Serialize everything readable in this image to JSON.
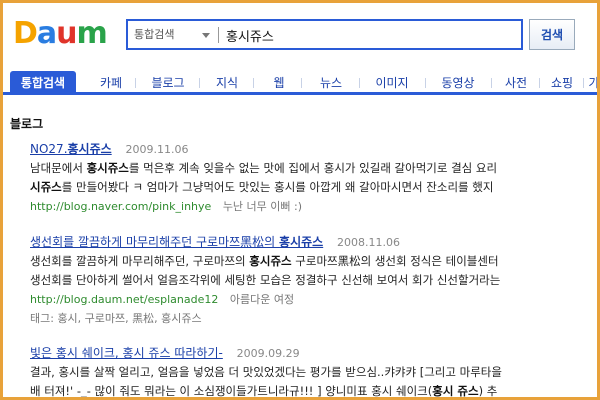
{
  "logo": {
    "letters": [
      "D",
      "a",
      "u",
      "m"
    ],
    "colors": [
      "#f5a300",
      "#2a7de1",
      "#e0342a",
      "#2aa34a"
    ]
  },
  "search": {
    "scope": "통합검색",
    "query": "홍시쥬스",
    "button": "검색"
  },
  "tabs": [
    {
      "label": "통합검색",
      "active": true
    },
    {
      "label": "카페"
    },
    {
      "label": "블로그"
    },
    {
      "label": "지식"
    },
    {
      "label": "웹"
    },
    {
      "label": "뉴스"
    },
    {
      "label": "이미지"
    },
    {
      "label": "동영상"
    },
    {
      "label": "사전"
    },
    {
      "label": "쇼핑"
    },
    {
      "label": "가"
    }
  ],
  "section_title": "블로그",
  "results": [
    {
      "title_pre": "NO27.",
      "title_hl": "홍시쥬스",
      "title_post": "",
      "date": "2009.11.06",
      "line1_pre": "남대문에서 ",
      "line1_hl": "홍시쥬스",
      "line1_post": "를 먹은후 계속 잊을수 없는 맛에 집에서 홍시가 있길래 갈아먹기로 결심 요리",
      "line2_pre": "",
      "line2_hl": "시쥬스",
      "line2_post": "를 만들어봤다 ㅋ 엄마가 그냥먹어도 맛있는 홍시를 아깝게 왜 갈아마시면서 잔소리를 했지",
      "url": "http://blog.naver.com/pink_inhye",
      "author": "누난 너무 이뻐 :)",
      "tags": ""
    },
    {
      "title_pre": "생선회를 깔끔하게 마무리해주던 구로마쯔黑松의 ",
      "title_hl": "홍시쥬스",
      "title_post": "",
      "date": "2008.11.06",
      "line1_pre": "생선회를 깔끔하게 마무리해주던, 구로마쯔의 ",
      "line1_hl": "홍시쥬스",
      "line1_post": " 구로마쯔黑松의 생선회 정식은 테이블센터",
      "line2_pre": "생선회를 단아하게 썰어서 얼음조각위에 세팅한 모습은 정결하구 신선해 보여서 회가 신선할거라는",
      "line2_hl": "",
      "line2_post": "",
      "url": "http://blog.daum.net/esplanade12",
      "author": "아름다운 여정",
      "tags": "태그: 홍시, 구로마쯔, 黑松, 홍시쥬스"
    },
    {
      "title_pre": "빛은 홍시 쉐이크, 홍시 쥬스 따라하기-",
      "title_hl": "",
      "title_post": "",
      "date": "2009.09.29",
      "line1_pre": "결과, 홍시를 살짝 얼리고, 얼음을 넣었음 더 맛있었겠다는 평가를 받으심..캬캬캬 [그리고 마루타을",
      "line1_hl": "",
      "line1_post": "",
      "line2_pre": "배 터져!' -_- 많이 줘도 뭐라는 이 소심쟁이들가트니라규!!! ] 양니미표 홍시 쉐이크(",
      "line2_hl": "홍시 쥬스",
      "line2_post": ") 추",
      "url": "",
      "author": "",
      "tags": ""
    }
  ]
}
